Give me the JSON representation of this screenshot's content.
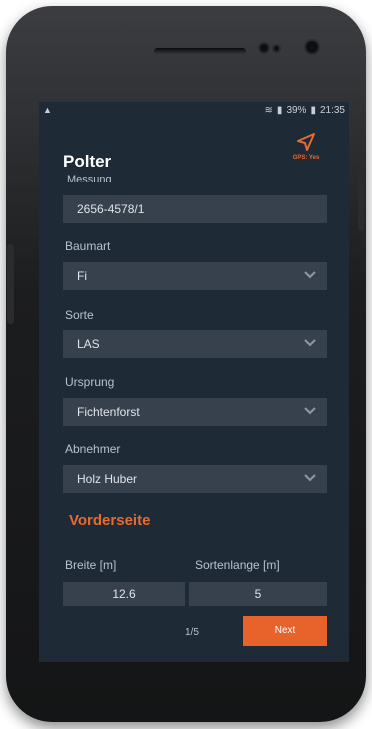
{
  "status": {
    "battery": "39%",
    "time": "21:35"
  },
  "app": {
    "title": "Polter",
    "gps_label": "GPS: Yes"
  },
  "form": {
    "messung_label": "Messung",
    "messung_value": "2656-4578/1",
    "baumart_label": "Baumart",
    "baumart_value": "Fi",
    "sorte_label": "Sorte",
    "sorte_value": "LAS",
    "ursprung_label": "Ursprung",
    "ursprung_value": "Fichtenforst",
    "abnehmer_label": "Abnehmer",
    "abnehmer_value": "Holz Huber"
  },
  "section": {
    "title": "Vorderseite",
    "breite_label": "Breite [m]",
    "breite_value": "12.6",
    "sortenlange_label": "Sortenlange [m]",
    "sortenlange_value": "5"
  },
  "footer": {
    "page": "1/5",
    "next_label": "Next"
  },
  "colors": {
    "accent": "#e8622b",
    "background": "#1f2a37",
    "field": "#37414d"
  },
  "icons": [
    "gps-navigation-icon",
    "chevron-down-icon",
    "wifi-icon",
    "battery-icon",
    "signal-icon"
  ]
}
